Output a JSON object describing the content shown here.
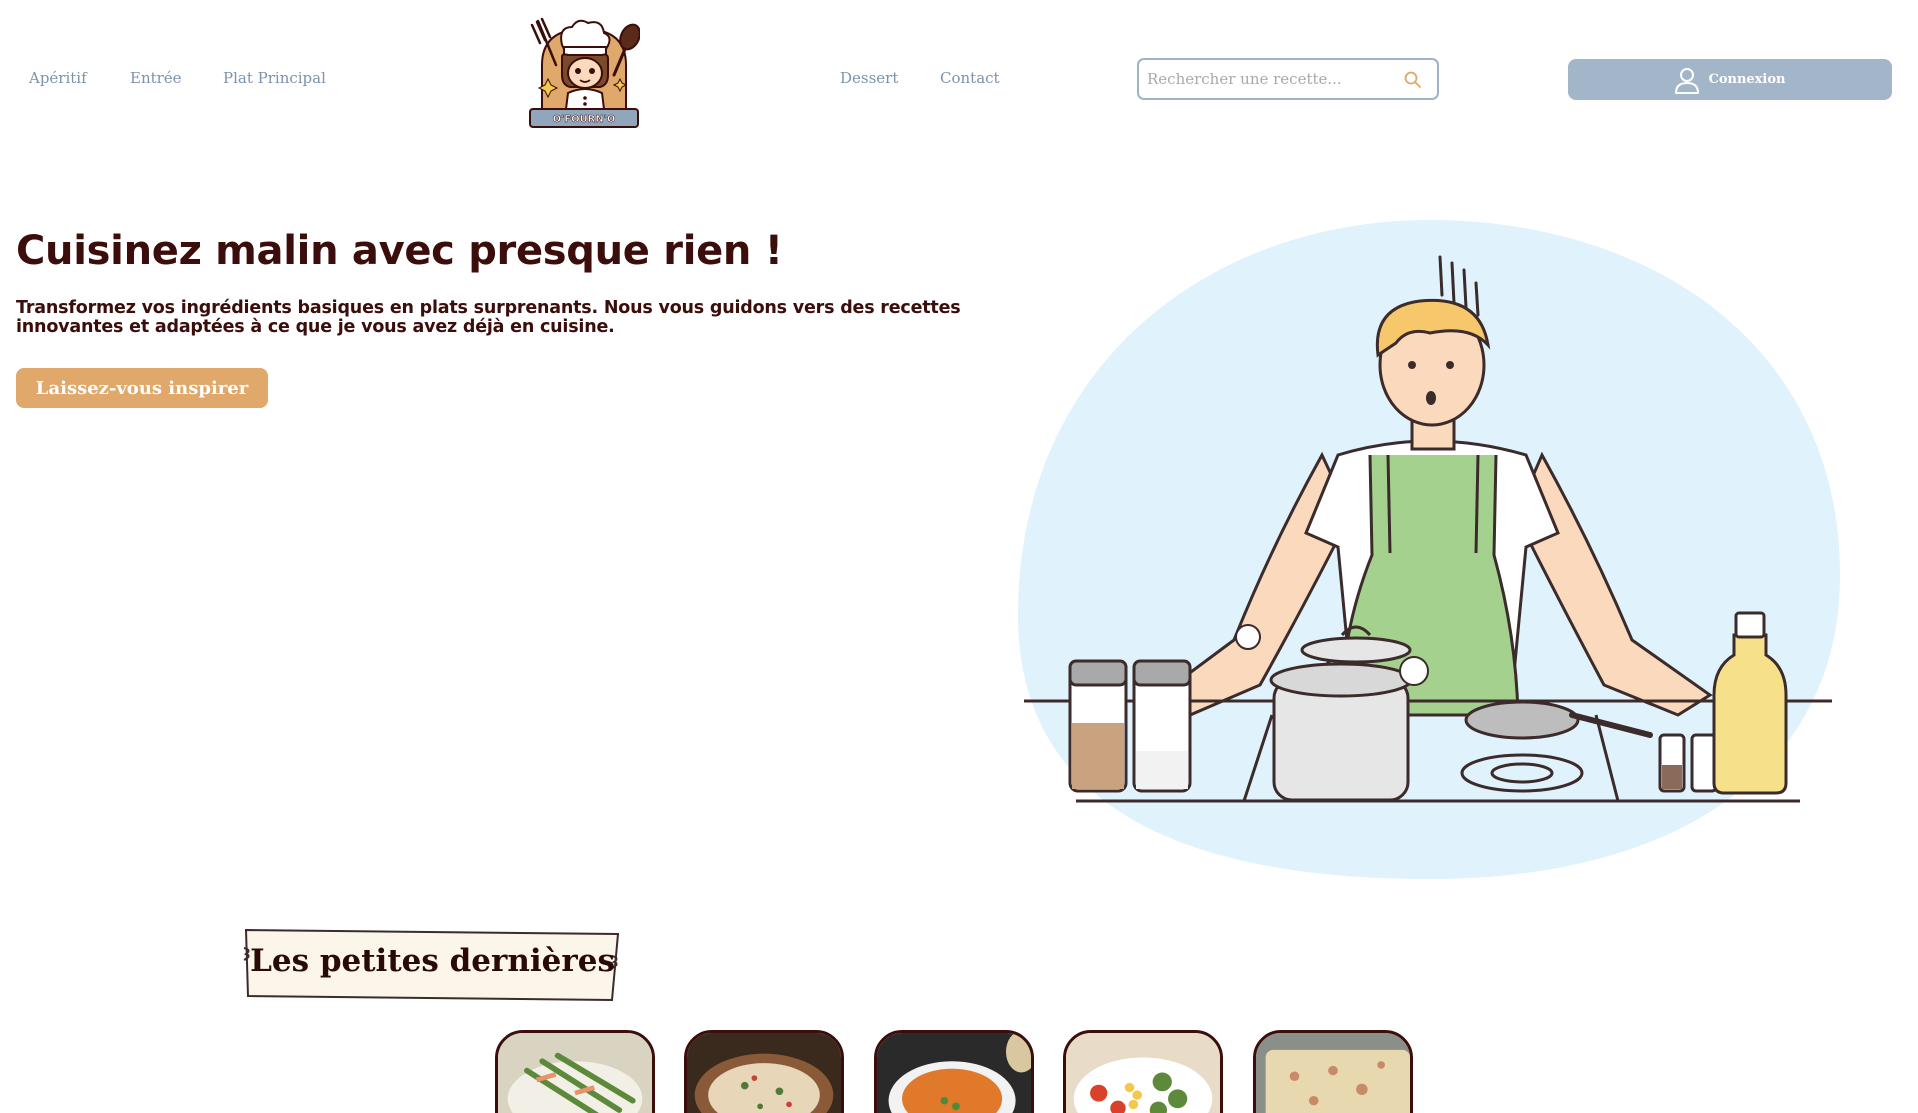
{
  "nav": {
    "left": [
      "Apéritif",
      "Entrée",
      "Plat Principal"
    ],
    "right": [
      "Dessert",
      "Contact"
    ]
  },
  "logo": {
    "text": "O'FOURN'O",
    "icon": "chef-logo-icon"
  },
  "search": {
    "placeholder": "Rechercher une recette...",
    "value": "",
    "icon": "search-icon"
  },
  "login": {
    "label": "Connexion",
    "icon": "user-icon"
  },
  "hero": {
    "title": "Cuisinez malin avec presque rien !",
    "subtitle": "Transformez vos ingrédients basiques en plats surprenants. Nous vous guidons vers des recettes innovantes et adaptées à ce que je vous avez déjà en cuisine.",
    "cta": "Laissez-vous inspirer"
  },
  "latest": {
    "title": "Les petites dernières",
    "cards": [
      {
        "image": "asparagus-salmon-dish"
      },
      {
        "image": "penne-pasta-bowl"
      },
      {
        "image": "carrot-soup-bowl"
      },
      {
        "image": "vegetable-salad-plate"
      },
      {
        "image": "gratin-dish"
      }
    ]
  },
  "colors": {
    "nav_text": "#7b93ad",
    "heading": "#3b0d0b",
    "accent": "#e0a86a",
    "login_bg": "#a3b6c9",
    "illustration_bg": "#e0f2fc"
  }
}
